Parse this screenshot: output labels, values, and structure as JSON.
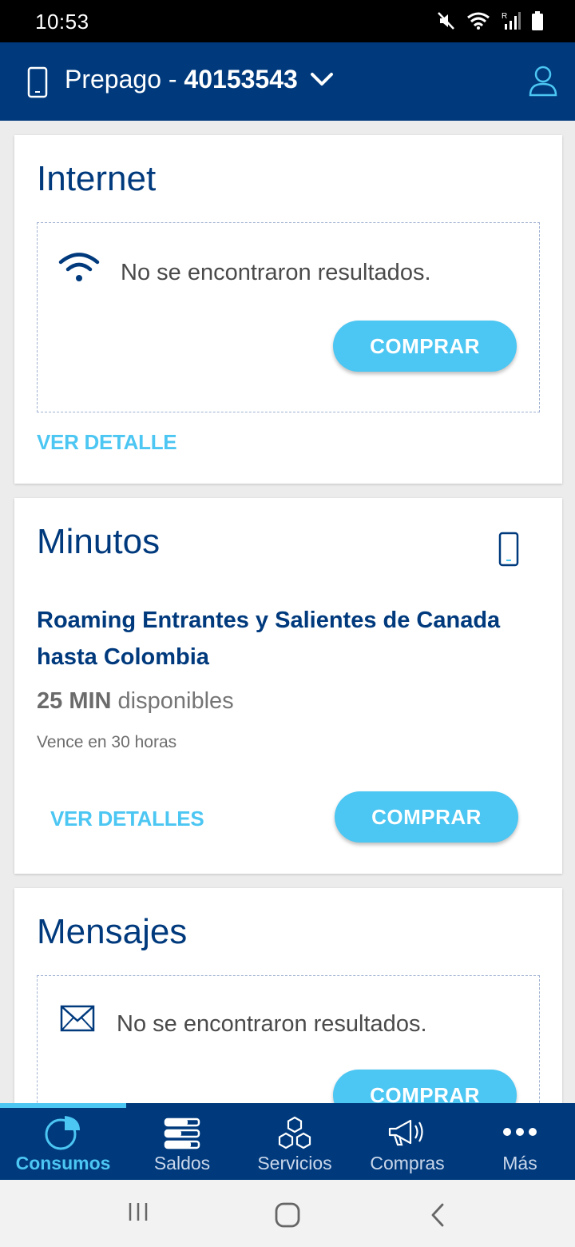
{
  "status_bar": {
    "time": "10:53",
    "signal_label": "R"
  },
  "header": {
    "plan_prefix": "Prepago - ",
    "line_number": "40153543"
  },
  "internet": {
    "title": "Internet",
    "empty_message": "No se encontraron resultados.",
    "buy_label": "COMPRAR",
    "detail_link": "VER DETALLE"
  },
  "minutos": {
    "title": "Minutos",
    "plan_name": "Roaming Entrantes y Salientes de Canada hasta Colombia",
    "amount": "25 MIN",
    "amount_suffix": " disponibles",
    "expiry": "Vence en 30 horas",
    "detail_link": "VER DETALLES",
    "buy_label": "COMPRAR"
  },
  "mensajes": {
    "title": "Mensajes",
    "empty_message": "No se encontraron resultados.",
    "buy_label": "COMPRAR"
  },
  "bottom_nav": {
    "items": [
      {
        "label": "Consumos",
        "icon": "pie-chart-icon",
        "active": true
      },
      {
        "label": "Saldos",
        "icon": "balance-bars-icon",
        "active": false
      },
      {
        "label": "Servicios",
        "icon": "hexagons-icon",
        "active": false
      },
      {
        "label": "Compras",
        "icon": "megaphone-icon",
        "active": false
      },
      {
        "label": "Más",
        "icon": "more-dots-icon",
        "active": false
      }
    ]
  },
  "colors": {
    "primary": "#003a7d",
    "accent": "#4cc6f2",
    "background": "#ececec"
  }
}
